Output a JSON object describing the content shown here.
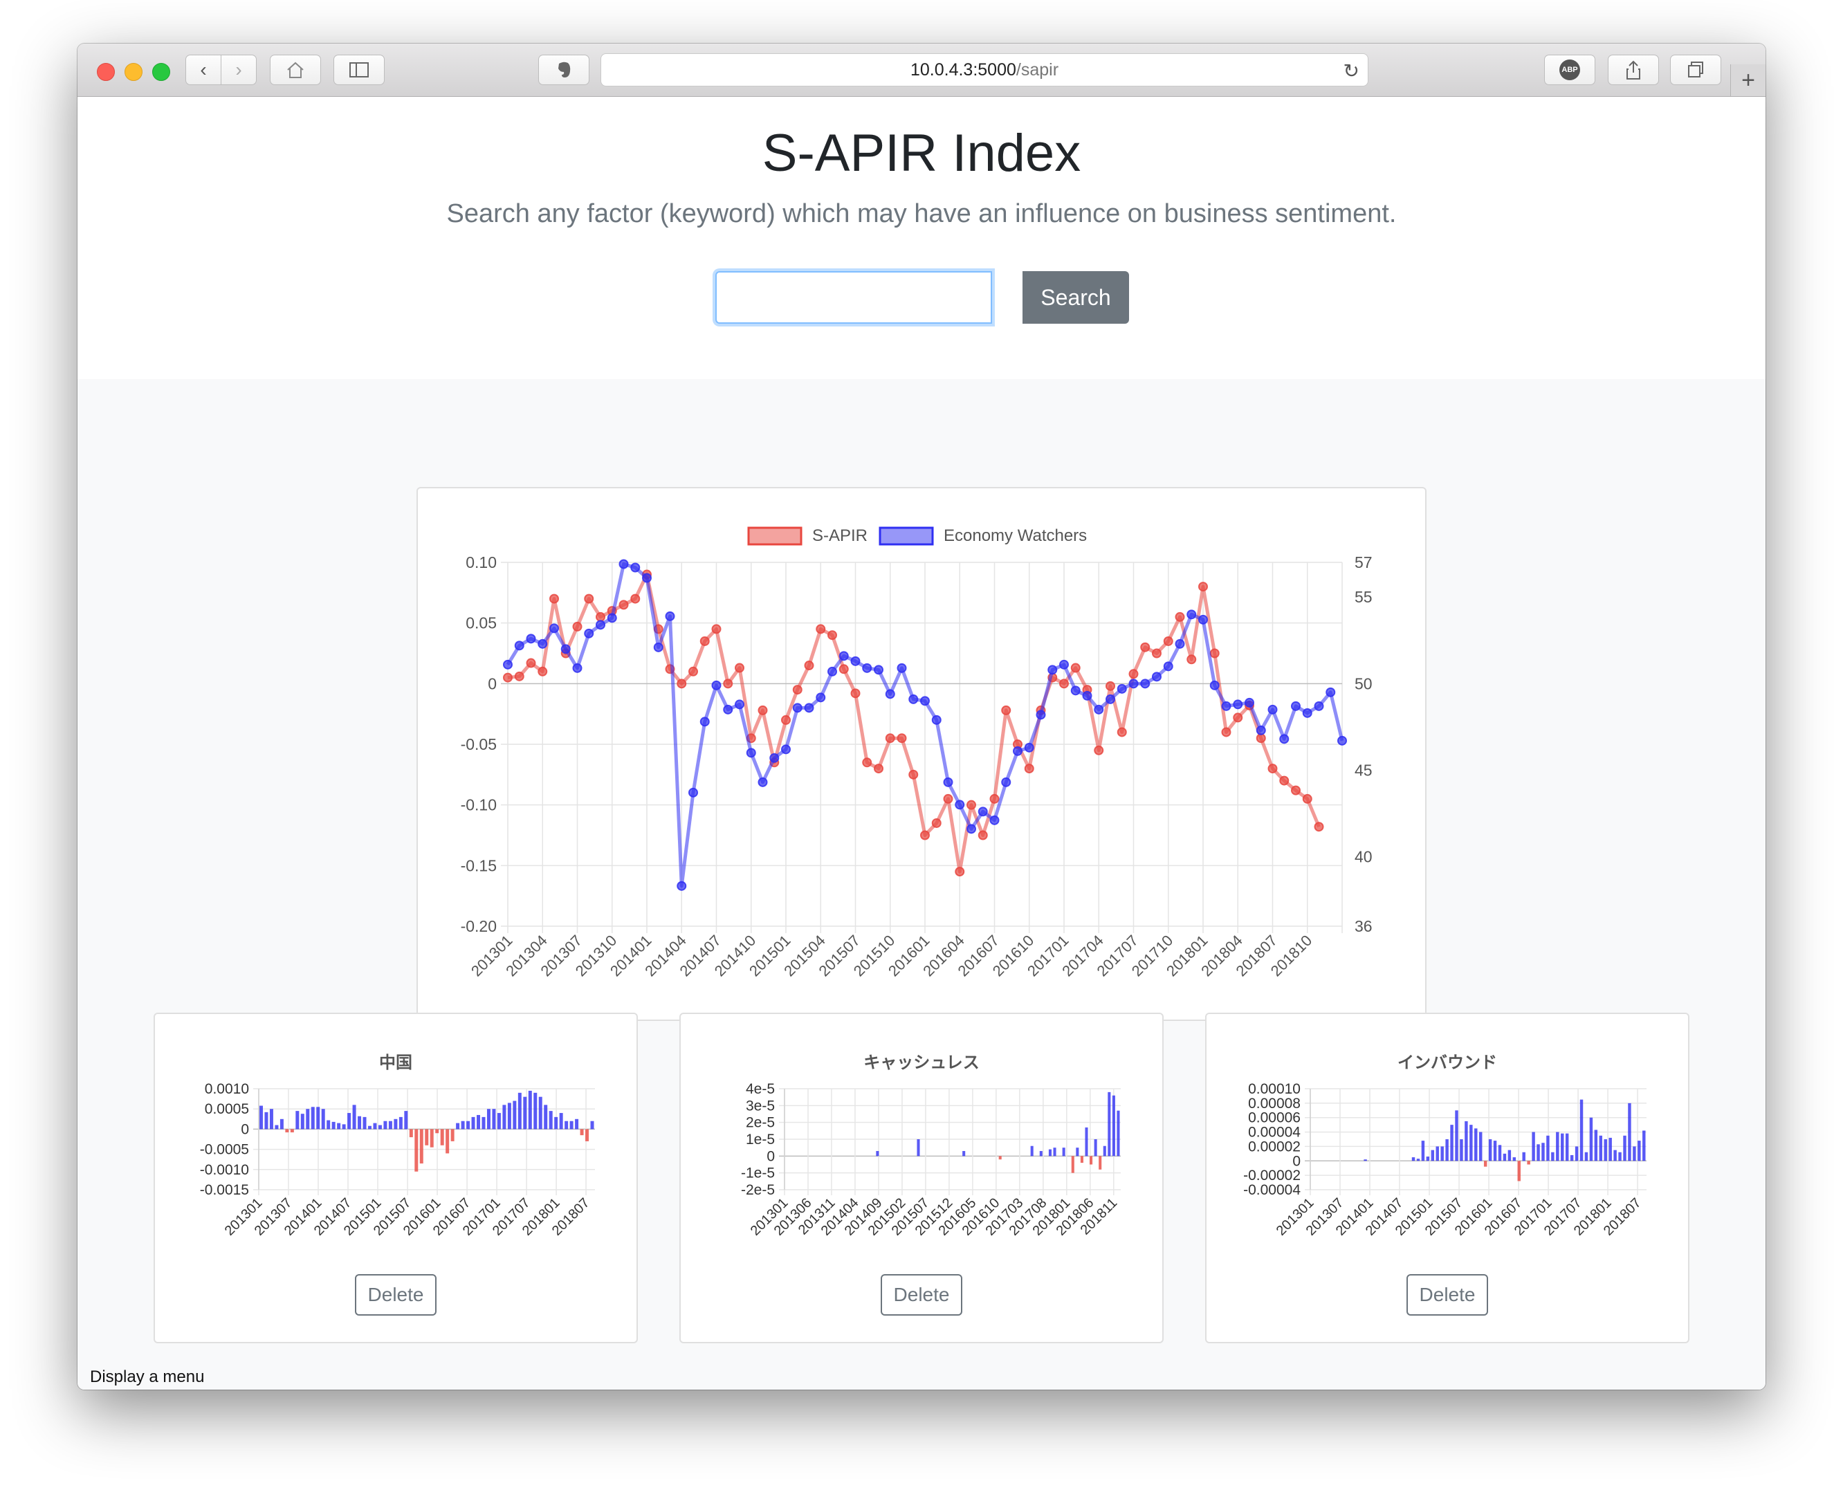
{
  "browser": {
    "url_host": "10.0.4.3:5000",
    "url_path": "/sapir",
    "abp_label": "ABP"
  },
  "header": {
    "title": "S-APIR Index",
    "lead": "Search any factor (keyword) which may have an influence on business sentiment.",
    "search_placeholder": "",
    "search_label": "Search"
  },
  "status_bar": "Display a menu",
  "chart_data": [
    {
      "type": "line",
      "x_labels": [
        "201301",
        "201304",
        "201307",
        "201310",
        "201401",
        "201404",
        "201407",
        "201410",
        "201501",
        "201504",
        "201507",
        "201510",
        "201601",
        "201604",
        "201607",
        "201610",
        "201701",
        "201704",
        "201707",
        "201710",
        "201801",
        "201804",
        "201807",
        "201810"
      ],
      "months_start": "201301",
      "series": [
        {
          "name": "S-APIR",
          "axis": "left",
          "color": "#e8473f",
          "values": [
            0.005,
            0.006,
            0.017,
            0.01,
            0.07,
            0.025,
            0.047,
            0.07,
            0.055,
            0.06,
            0.065,
            0.07,
            0.09,
            0.045,
            0.012,
            0.0,
            0.01,
            0.035,
            0.045,
            0.0,
            0.013,
            -0.045,
            -0.022,
            -0.065,
            -0.03,
            -0.005,
            0.015,
            0.045,
            0.04,
            0.012,
            -0.008,
            -0.065,
            -0.07,
            -0.045,
            -0.045,
            -0.075,
            -0.125,
            -0.115,
            -0.095,
            -0.155,
            -0.1,
            -0.125,
            -0.095,
            -0.022,
            -0.05,
            -0.07,
            -0.022,
            0.005,
            0.0,
            0.013,
            -0.005,
            -0.055,
            -0.002,
            -0.04,
            0.008,
            0.03,
            0.025,
            0.035,
            0.055,
            0.02,
            0.08,
            0.025,
            -0.04,
            -0.028,
            -0.018,
            -0.045,
            -0.07,
            -0.08,
            -0.088,
            -0.095,
            -0.118
          ]
        },
        {
          "name": "Economy Watchers",
          "axis": "right",
          "color": "#2f2ff2",
          "values": [
            51.1,
            52.2,
            52.6,
            52.3,
            53.2,
            52.0,
            50.9,
            52.9,
            53.4,
            53.8,
            56.9,
            56.7,
            56.1,
            52.1,
            53.9,
            38.3,
            43.7,
            47.8,
            49.9,
            48.5,
            48.8,
            46.0,
            44.3,
            45.7,
            46.2,
            48.6,
            48.6,
            49.2,
            50.7,
            51.6,
            51.3,
            50.9,
            50.8,
            49.4,
            50.9,
            49.1,
            49.0,
            47.9,
            44.3,
            43.0,
            41.6,
            42.6,
            42.1,
            44.3,
            46.1,
            46.3,
            48.2,
            50.8,
            51.1,
            49.6,
            49.3,
            48.5,
            49.1,
            49.7,
            50.0,
            50.0,
            50.4,
            51.0,
            52.3,
            54.0,
            53.7,
            49.9,
            48.7,
            48.8,
            48.9,
            47.3,
            48.5,
            46.8,
            48.7,
            48.3,
            48.7,
            49.5,
            46.7
          ]
        }
      ],
      "y_left": {
        "min": -0.2,
        "max": 0.1,
        "ticks": [
          "0.10",
          "0.05",
          "0",
          "-0.05",
          "-0.10",
          "-0.15",
          "-0.20"
        ]
      },
      "y_right": {
        "ticks": [
          "57",
          "55",
          "50",
          "45",
          "40",
          "36"
        ]
      },
      "legend": "top"
    },
    {
      "type": "bar",
      "title": "中国",
      "x_labels": [
        "201301",
        "201307",
        "201401",
        "201407",
        "201501",
        "201507",
        "201601",
        "201607",
        "201701",
        "201707",
        "201801",
        "201807"
      ],
      "y_ticks": [
        "0.0010",
        "0.0005",
        "0",
        "-0.0005",
        "-0.0010",
        "-0.0015"
      ],
      "ylim": [
        -0.0015,
        0.001
      ],
      "values": [
        0.00058,
        0.00042,
        0.0005,
        0.0001,
        0.00025,
        -8e-05,
        -8e-05,
        0.00045,
        0.00038,
        0.0005,
        0.00055,
        0.00055,
        0.0005,
        0.00022,
        0.00018,
        0.00015,
        0.00012,
        0.0004,
        0.0006,
        0.00032,
        0.0003,
        8e-05,
        0.00015,
        0.0001,
        0.0002,
        0.0002,
        0.00025,
        0.0003,
        0.00045,
        -0.0002,
        -0.00105,
        -0.00085,
        -0.0004,
        -0.00045,
        -0.0001,
        -0.0004,
        -0.0006,
        -0.0003,
        0.00015,
        0.0002,
        0.0002,
        0.0003,
        0.00035,
        0.0003,
        0.0005,
        0.0005,
        0.0004,
        0.0006,
        0.00065,
        0.0007,
        0.0009,
        0.0008,
        0.00095,
        0.0009,
        0.0008,
        0.0006,
        0.00045,
        0.0003,
        0.0004,
        0.0002,
        0.0002,
        0.00025,
        -0.00015,
        -0.0003,
        0.0002
      ]
    },
    {
      "type": "bar",
      "title": "キャッシュレス",
      "x_labels": [
        "201301",
        "201306",
        "201311",
        "201404",
        "201409",
        "201502",
        "201507",
        "201512",
        "201605",
        "201610",
        "201703",
        "201708",
        "201801",
        "201806",
        "201811"
      ],
      "y_ticks": [
        "4e-5",
        "3e-5",
        "2e-5",
        "1e-5",
        "0",
        "-1e-5",
        "-2e-5"
      ],
      "ylim": [
        -2e-05,
        4e-05
      ],
      "values": [
        0,
        0,
        0,
        0,
        0,
        0,
        0,
        0,
        0,
        0,
        0,
        0,
        0,
        0,
        0,
        0,
        0,
        0,
        0,
        0,
        3e-06,
        0,
        0,
        0,
        0,
        0,
        0,
        0,
        0,
        1e-05,
        0,
        0,
        0,
        0,
        0,
        0,
        0,
        0,
        0,
        3e-06,
        0,
        0,
        0,
        0,
        0,
        0,
        0,
        -2e-06,
        0,
        0,
        0,
        0,
        0,
        0,
        6e-06,
        0,
        3e-06,
        0,
        4e-06,
        5e-06,
        0,
        5e-06,
        0,
        -1e-05,
        5e-06,
        -4e-06,
        1.7e-05,
        -5e-06,
        1e-05,
        -8e-06,
        6e-06,
        3.8e-05,
        3.6e-05,
        2.7e-05
      ]
    },
    {
      "type": "bar",
      "title": "インバウンド",
      "x_labels": [
        "201301",
        "201307",
        "201401",
        "201407",
        "201501",
        "201507",
        "201601",
        "201607",
        "201701",
        "201707",
        "201801",
        "201807"
      ],
      "y_ticks": [
        "0.00010",
        "0.00008",
        "0.00006",
        "0.00004",
        "0.00002",
        "0",
        "-0.00002",
        "-0.00004"
      ],
      "ylim": [
        -4e-05,
        0.0001
      ],
      "values": [
        0,
        0,
        0,
        0,
        0,
        0,
        0,
        0,
        0,
        0,
        0,
        2e-06,
        0,
        0,
        0,
        0,
        0,
        0,
        0,
        0,
        0,
        5e-06,
        3e-06,
        2.8e-05,
        6e-06,
        1.5e-05,
        2e-05,
        2e-05,
        3e-05,
        5e-05,
        7e-05,
        3e-05,
        5.5e-05,
        5e-05,
        4.5e-05,
        4e-05,
        -8e-06,
        3e-05,
        2.8e-05,
        2.2e-05,
        1e-05,
        1.5e-05,
        5e-06,
        -2.8e-05,
        1.2e-05,
        -5e-06,
        4e-05,
        2.3e-05,
        2.5e-05,
        3.5e-05,
        1.2e-05,
        4e-05,
        3.8e-05,
        3.8e-05,
        8e-06,
        2e-05,
        8.5e-05,
        1.2e-05,
        6e-05,
        4.3e-05,
        3.5e-05,
        3e-05,
        3.2e-05,
        1.5e-05,
        1.2e-05,
        3.5e-05,
        8e-05,
        2e-05,
        2.8e-05,
        4.2e-05
      ]
    }
  ],
  "cards": [
    {
      "delete_label": "Delete"
    },
    {
      "delete_label": "Delete"
    },
    {
      "delete_label": "Delete"
    }
  ]
}
